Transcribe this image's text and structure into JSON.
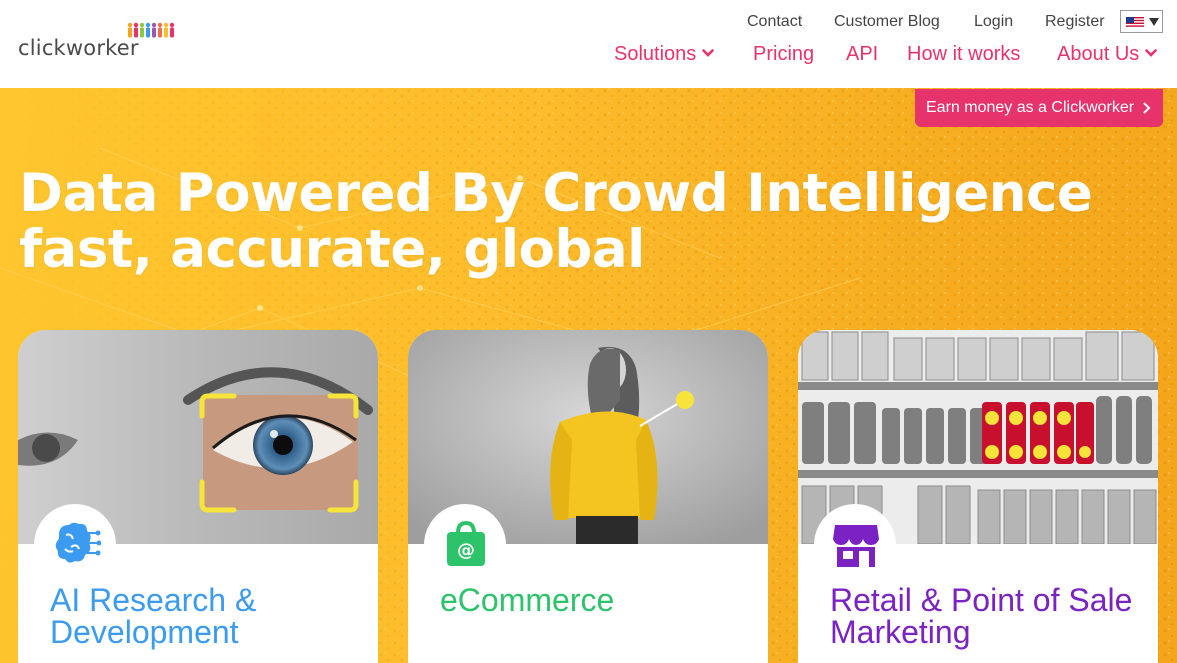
{
  "brand": {
    "logo_text": "clickworker"
  },
  "top_links": [
    "Contact",
    "Customer Blog",
    "Login",
    "Register"
  ],
  "language": {
    "selected": "US",
    "flag": "us-flag-icon"
  },
  "nav": {
    "solutions": "Solutions",
    "pricing": "Pricing",
    "api": "API",
    "how_it_works": "How it works",
    "about_us": "About Us"
  },
  "hero": {
    "earn_button": "Earn money as a Clickworker",
    "headline_line1": "Data Powered By Crowd Intelligence",
    "headline_line2": "fast, accurate, global"
  },
  "cards": [
    {
      "title": "AI Research & Development",
      "icon": "brain-circuit-icon",
      "color": "#3b9bf0"
    },
    {
      "title": "eCommerce",
      "icon": "shopping-bag-icon",
      "color": "#2cc36b"
    },
    {
      "title": "Retail & Point of Sale Marketing",
      "icon": "storefront-icon",
      "color": "#7a22c4"
    }
  ],
  "colors": {
    "accent": "#e8336a",
    "hero_yellow": "#fdbd2c",
    "marker_yellow": "#f7e43a"
  }
}
